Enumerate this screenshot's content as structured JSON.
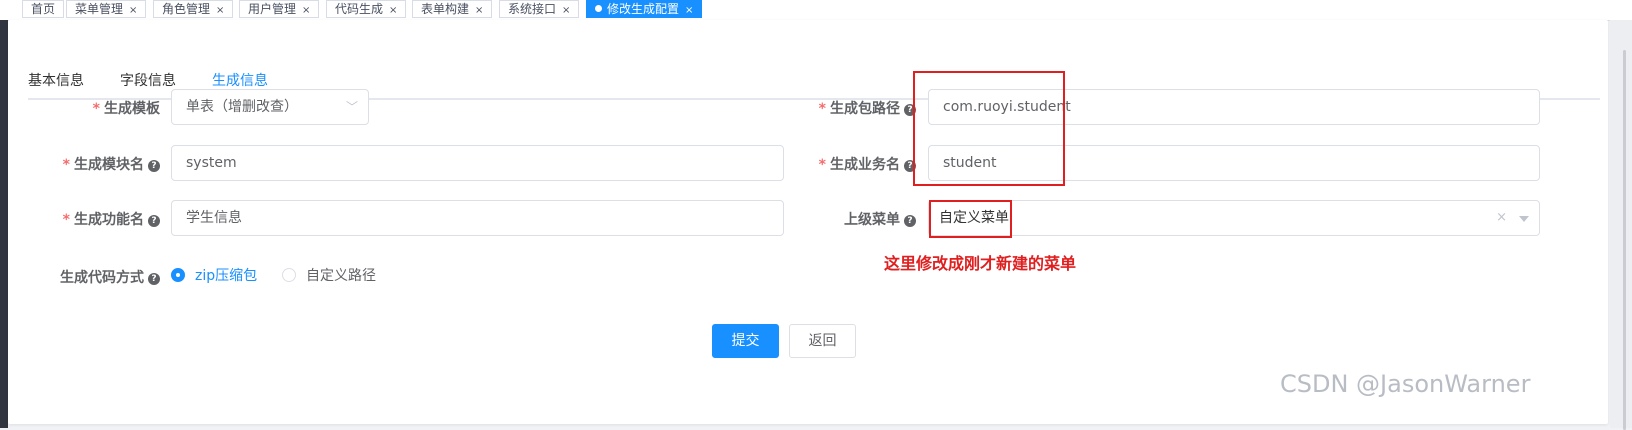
{
  "tags": [
    {
      "label": "首页",
      "closable": false,
      "active": false
    },
    {
      "label": "菜单管理",
      "closable": true,
      "active": false
    },
    {
      "label": "角色管理",
      "closable": true,
      "active": false
    },
    {
      "label": "用户管理",
      "closable": true,
      "active": false
    },
    {
      "label": "代码生成",
      "closable": true,
      "active": false
    },
    {
      "label": "表单构建",
      "closable": true,
      "active": false
    },
    {
      "label": "系统接口",
      "closable": true,
      "active": false
    },
    {
      "label": "修改生成配置",
      "closable": true,
      "active": true
    }
  ],
  "close_glyph": "×",
  "tabs": [
    "基本信息",
    "字段信息",
    "生成信息"
  ],
  "active_tab": "生成信息",
  "form": {
    "required_mark": "*",
    "help_glyph": "?",
    "template": {
      "label": "生成模板",
      "value": "单表（增删改查）"
    },
    "package_path": {
      "label": "生成包路径",
      "value": "com.ruoyi.student"
    },
    "module_name": {
      "label": "生成模块名",
      "value": "system"
    },
    "business_name": {
      "label": "生成业务名",
      "value": "student"
    },
    "function_name": {
      "label": "生成功能名",
      "value": "学生信息"
    },
    "parent_menu": {
      "label": "上级菜单",
      "value": "自定义菜单"
    },
    "gen_type": {
      "label": "生成代码方式",
      "options": [
        "zip压缩包",
        "自定义路径"
      ],
      "selected": "zip压缩包"
    }
  },
  "buttons": {
    "submit": "提交",
    "back": "返回"
  },
  "annotation": "这里修改成刚才新建的菜单",
  "watermark": "CSDN @JasonWarner",
  "colors": {
    "accent": "#1890ff",
    "annotation": "#e02020",
    "required": "#f56c6c"
  }
}
